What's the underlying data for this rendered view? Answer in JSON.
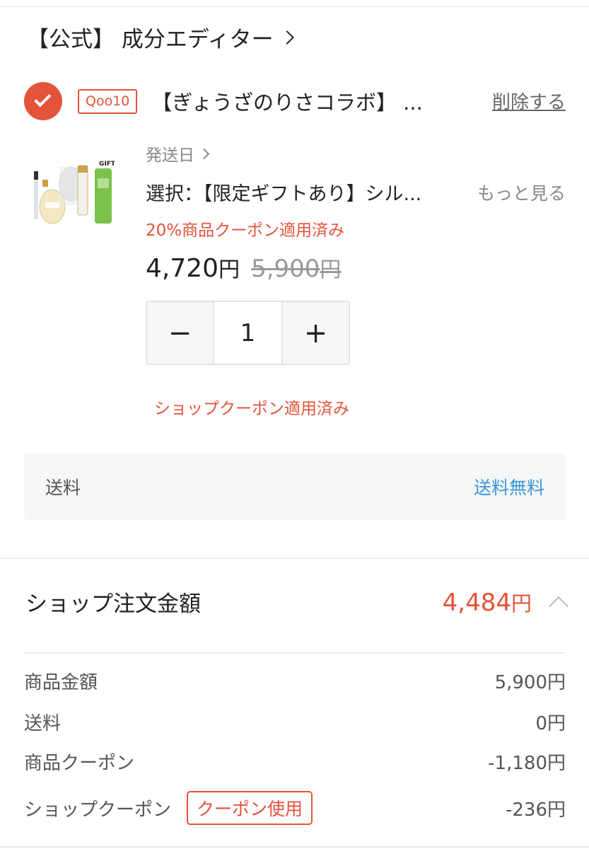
{
  "shop": {
    "name": "【公式】 成分エディター"
  },
  "item": {
    "store_badge": "Qoo10",
    "title": "【ぎょうざのりさコラボ】 ...",
    "delete_label": "削除する",
    "ship_date_label": "発送日",
    "option": "選択：【限定ギフトあり】シル...",
    "more_label": "もっと見る",
    "coupon_applied": "20%商品クーポン適用済み",
    "price": "4,720",
    "price_unit": "円",
    "original_price": "5,900",
    "original_unit": "円",
    "quantity": "1",
    "minus": "−",
    "plus": "+",
    "shop_coupon_applied": "ショップクーポン適用済み",
    "image_gift_text": "GIFT"
  },
  "shipping": {
    "label": "送料",
    "value": "送料無料"
  },
  "order": {
    "label": "ショップ注文金額",
    "total": "4,484",
    "total_unit": "円",
    "rows": [
      {
        "label": "商品金額",
        "value": "5,900円"
      },
      {
        "label": "送料",
        "value": "0円"
      },
      {
        "label": "商品クーポン",
        "value": "-1,180円"
      },
      {
        "label": "ショップクーポン",
        "value": "-236円"
      }
    ],
    "use_coupon_label": "クーポン使用"
  },
  "colors": {
    "accent": "#e4533a",
    "link_blue": "#3a97d4"
  }
}
